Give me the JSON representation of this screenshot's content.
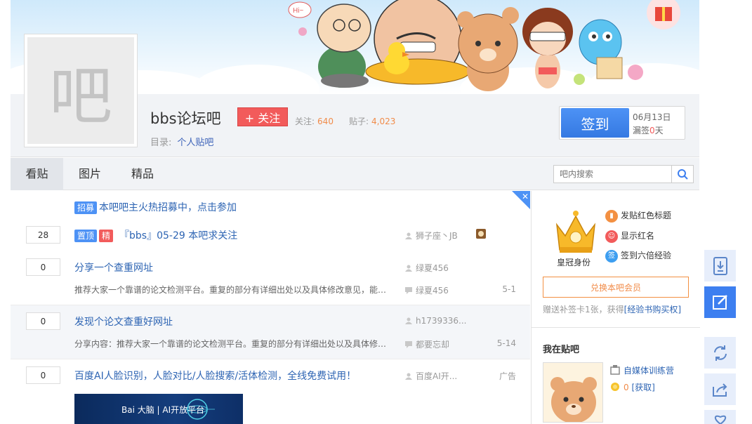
{
  "forum": {
    "avatar_char": "吧",
    "name": "bbs论坛吧",
    "follow_label": "+ 关注",
    "follow_prefix": "关注:",
    "follow_count": "640",
    "posts_prefix": "贴子:",
    "posts_count": "4,023",
    "dir_prefix": "目录:",
    "dir_value": "个人贴吧"
  },
  "sign": {
    "button_label": "签到",
    "date": "06月13日",
    "missed_prefix": "漏签",
    "missed_days": "0",
    "missed_suffix": "天"
  },
  "nav": {
    "tabs": [
      {
        "label": "看贴",
        "active": true
      },
      {
        "label": "图片",
        "active": false
      },
      {
        "label": "精品",
        "active": false
      }
    ],
    "search_placeholder": "吧内搜索"
  },
  "threads": [
    {
      "tags": [
        {
          "text": "招募",
          "color": "#4d92f5"
        }
      ],
      "title": "本吧吧主火热招募中，点击参加"
    },
    {
      "reply_count": "28",
      "tags": [
        {
          "text": "置顶",
          "color": "#4d92f5"
        },
        {
          "text": "精",
          "color": "#f25b5b"
        }
      ],
      "title": "『bbs』05-29 本吧求关注",
      "author": "狮子座丶JB"
    },
    {
      "reply_count": "0",
      "title": "分享一个查重网址",
      "author": "绿夏456",
      "excerpt": "推荐大家一个靠谱的论文检测平台。重复的部分有详细出处以及具体修改意见，能直接在文章上做修改，",
      "last_reply": "绿夏456",
      "time": "5-1"
    },
    {
      "reply_count": "0",
      "title": "发现个论文查重好网址",
      "author": "h1739336...",
      "excerpt": "分享内容：推荐大家一个靠谱的论文检测平台。重复的部分有详细出处以及具体修改意见，能直接",
      "last_reply": "都要忘却",
      "time": "5-14"
    },
    {
      "reply_count": "0",
      "title": "百度AI人脸识别，人脸对比/人脸搜索/活体检测，全线免费试用！",
      "author": "百度AI开...",
      "time": "广告"
    }
  ],
  "ad": {
    "banner_text": "Bai 大脑 | AI开放平台"
  },
  "sidebar": {
    "crown_label": "皇冠身份",
    "perks": [
      {
        "label": "发贴红色标题",
        "icon": "bookmark-icon",
        "color": "#f39042"
      },
      {
        "label": "显示红名",
        "icon": "chat-icon",
        "color": "#f25b5b"
      },
      {
        "label": "签到六倍经验",
        "icon": "sign-icon",
        "color": "#3d9ef0",
        "glyph": "签"
      }
    ],
    "member_button": "兑换本吧会员",
    "gift_text": "赠送补签卡1张，获得",
    "gift_link": "[经验书购买权]",
    "my_title": "我在贴吧",
    "my_items": [
      {
        "label": "自媒体训练营",
        "icon": "camp-icon"
      },
      {
        "label_count": "0",
        "label_link": "[获取]",
        "icon": "coin-icon"
      }
    ]
  },
  "float_toolbar": [
    "download-icon",
    "edit-icon",
    "refresh-icon",
    "share-icon"
  ]
}
